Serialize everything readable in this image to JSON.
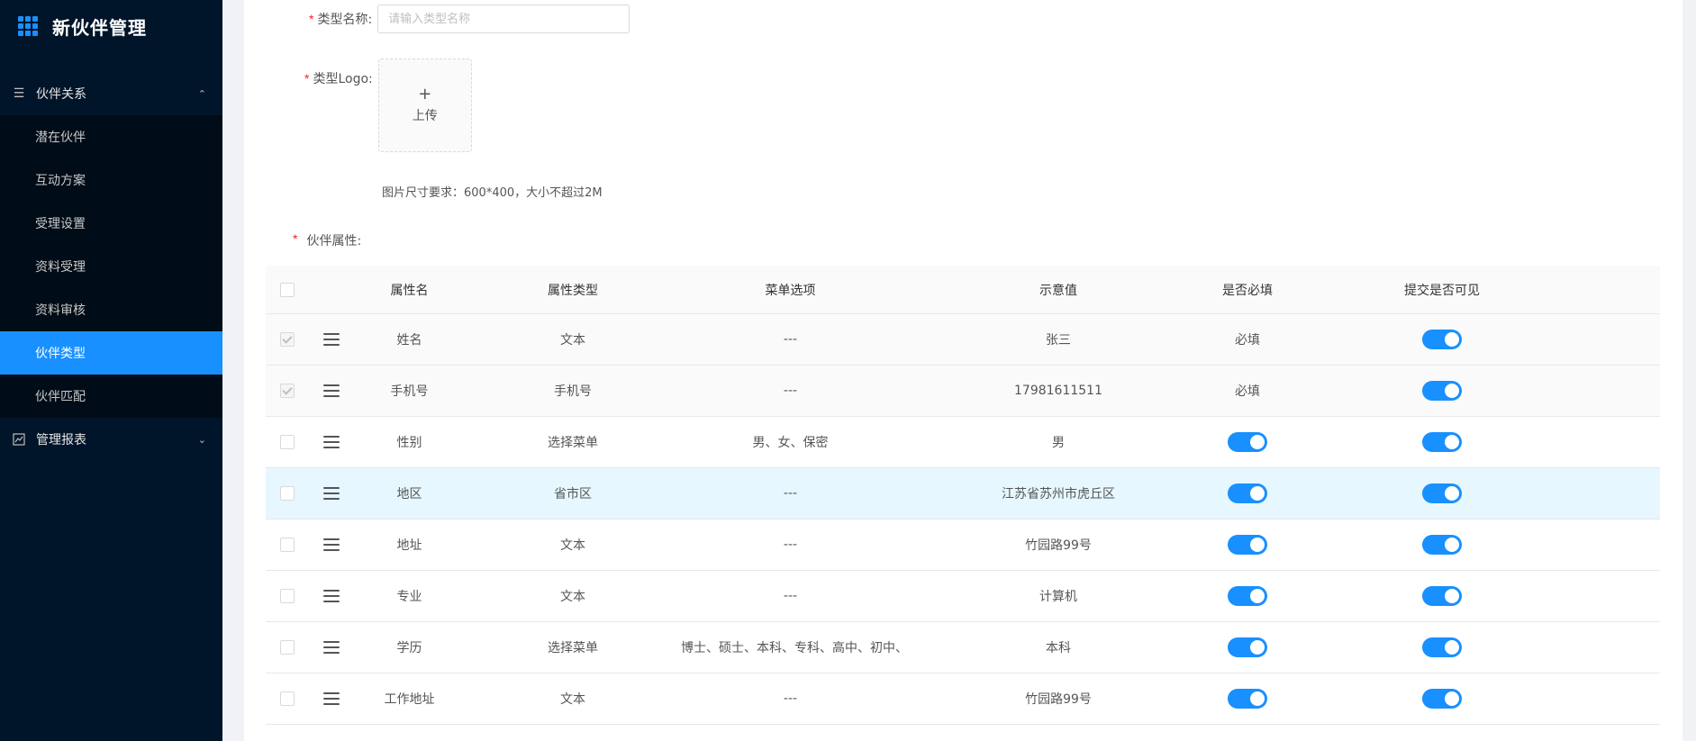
{
  "app": {
    "title": "新伙伴管理"
  },
  "sidebar": {
    "groups": [
      {
        "label": "伙伴关系",
        "expanded": true,
        "items": [
          {
            "label": "潜在伙伴"
          },
          {
            "label": "互动方案"
          },
          {
            "label": "受理设置"
          },
          {
            "label": "资料受理"
          },
          {
            "label": "资料审核"
          },
          {
            "label": "伙伴类型",
            "active": true
          },
          {
            "label": "伙伴匹配"
          }
        ]
      },
      {
        "label": "管理报表",
        "expanded": false
      }
    ]
  },
  "form": {
    "type_name": {
      "label": "类型名称:",
      "placeholder": "请输入类型名称",
      "value": ""
    },
    "type_logo": {
      "label": "类型Logo:",
      "upload_label": "上传",
      "upload_icon": "+"
    },
    "image_hint": "图片尺寸要求：600*400，大小不超过2M",
    "attributes_label": "伙伴属性:"
  },
  "table": {
    "headers": [
      "属性名",
      "属性类型",
      "菜单选项",
      "示意值",
      "是否必填",
      "提交是否可见"
    ],
    "rows": [
      {
        "name": "姓名",
        "type": "文本",
        "options": "---",
        "sample": "张三",
        "required": "必填",
        "required_switch": false,
        "visible": true,
        "locked": true
      },
      {
        "name": "手机号",
        "type": "手机号",
        "options": "---",
        "sample": "17981611511",
        "required": "必填",
        "required_switch": false,
        "visible": true,
        "locked": true
      },
      {
        "name": "性别",
        "type": "选择菜单",
        "options": "男、女、保密",
        "sample": "男",
        "required_switch": true,
        "visible": true
      },
      {
        "name": "地区",
        "type": "省市区",
        "options": "---",
        "sample": "江苏省苏州市虎丘区",
        "required_switch": true,
        "visible": true,
        "highlight": true
      },
      {
        "name": "地址",
        "type": "文本",
        "options": "---",
        "sample": "竹园路99号",
        "required_switch": true,
        "visible": true
      },
      {
        "name": "专业",
        "type": "文本",
        "options": "---",
        "sample": "计算机",
        "required_switch": true,
        "visible": true
      },
      {
        "name": "学历",
        "type": "选择菜单",
        "options": "博士、硕士、本科、专科、高中、初中、小学、其他",
        "sample": "本科",
        "required_switch": true,
        "visible": true
      },
      {
        "name": "工作地址",
        "type": "文本",
        "options": "---",
        "sample": "竹园路99号",
        "required_switch": true,
        "visible": true
      }
    ]
  },
  "colors": {
    "sidebar_bg": "#001529",
    "accent": "#1890ff",
    "required_star": "#f5222d",
    "row_highlight": "#e6f7ff"
  }
}
